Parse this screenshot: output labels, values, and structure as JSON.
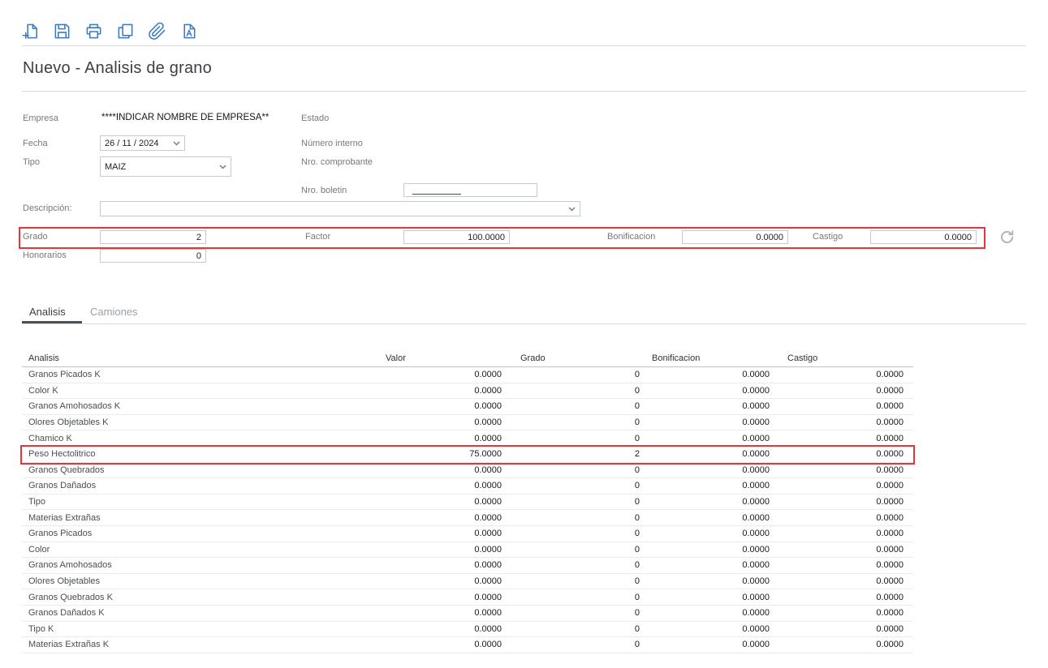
{
  "title": "Nuevo - Analisis de grano",
  "toolbar": {
    "icons": [
      "new-document-icon",
      "save-icon",
      "print-icon",
      "copy-icon",
      "paperclip-icon",
      "text-a-icon"
    ]
  },
  "form": {
    "empresa": {
      "label": "Empresa",
      "value": "****INDICAR NOMBRE DE EMPRESA**"
    },
    "estado": {
      "label": "Estado"
    },
    "fecha": {
      "label": "Fecha",
      "value": "26 / 11 /  2024"
    },
    "numero_interno": {
      "label": "Número interno"
    },
    "tipo": {
      "label": "Tipo",
      "value": "MAIZ"
    },
    "nro_comprobante": {
      "label": "Nro. comprobante"
    },
    "nro_boletin": {
      "label": "Nro. boletin",
      "value": ""
    },
    "descripcion": {
      "label": "Descripción:",
      "value": ""
    },
    "grado": {
      "label": "Grado",
      "value": "2"
    },
    "factor": {
      "label": "Factor",
      "value": "100.0000"
    },
    "bonificacion": {
      "label": "Bonificacion",
      "value": "0.0000"
    },
    "castigo": {
      "label": "Castigo",
      "value": "0.0000"
    },
    "honorarios": {
      "label": "Honorarios",
      "value": "0"
    }
  },
  "tabs": [
    {
      "label": "Analisis",
      "active": true
    },
    {
      "label": "Camiones",
      "active": false
    }
  ],
  "table": {
    "headers": [
      "Analisis",
      "Valor",
      "Grado",
      "Bonificacion",
      "Castigo"
    ],
    "rows": [
      {
        "analisis": "Granos Picados K",
        "valor": "0.0000",
        "grado": "0",
        "bonificacion": "0.0000",
        "castigo": "0.0000"
      },
      {
        "analisis": "Color K",
        "valor": "0.0000",
        "grado": "0",
        "bonificacion": "0.0000",
        "castigo": "0.0000"
      },
      {
        "analisis": "Granos Amohosados K",
        "valor": "0.0000",
        "grado": "0",
        "bonificacion": "0.0000",
        "castigo": "0.0000"
      },
      {
        "analisis": "Olores Objetables K",
        "valor": "0.0000",
        "grado": "0",
        "bonificacion": "0.0000",
        "castigo": "0.0000"
      },
      {
        "analisis": "Chamico K",
        "valor": "0.0000",
        "grado": "0",
        "bonificacion": "0.0000",
        "castigo": "0.0000"
      },
      {
        "analisis": "Peso Hectolitrico",
        "valor": "75.0000",
        "grado": "2",
        "bonificacion": "0.0000",
        "castigo": "0.0000",
        "highlight": true
      },
      {
        "analisis": "Granos Quebrados",
        "valor": "0.0000",
        "grado": "0",
        "bonificacion": "0.0000",
        "castigo": "0.0000"
      },
      {
        "analisis": "Granos Dañados",
        "valor": "0.0000",
        "grado": "0",
        "bonificacion": "0.0000",
        "castigo": "0.0000"
      },
      {
        "analisis": "Tipo",
        "valor": "0.0000",
        "grado": "0",
        "bonificacion": "0.0000",
        "castigo": "0.0000"
      },
      {
        "analisis": "Materias Extrañas",
        "valor": "0.0000",
        "grado": "0",
        "bonificacion": "0.0000",
        "castigo": "0.0000"
      },
      {
        "analisis": "Granos Picados",
        "valor": "0.0000",
        "grado": "0",
        "bonificacion": "0.0000",
        "castigo": "0.0000"
      },
      {
        "analisis": "Color",
        "valor": "0.0000",
        "grado": "0",
        "bonificacion": "0.0000",
        "castigo": "0.0000"
      },
      {
        "analisis": "Granos Amohosados",
        "valor": "0.0000",
        "grado": "0",
        "bonificacion": "0.0000",
        "castigo": "0.0000"
      },
      {
        "analisis": "Olores Objetables",
        "valor": "0.0000",
        "grado": "0",
        "bonificacion": "0.0000",
        "castigo": "0.0000"
      },
      {
        "analisis": "Granos Quebrados K",
        "valor": "0.0000",
        "grado": "0",
        "bonificacion": "0.0000",
        "castigo": "0.0000"
      },
      {
        "analisis": "Granos Dañados K",
        "valor": "0.0000",
        "grado": "0",
        "bonificacion": "0.0000",
        "castigo": "0.0000"
      },
      {
        "analisis": "Tipo K",
        "valor": "0.0000",
        "grado": "0",
        "bonificacion": "0.0000",
        "castigo": "0.0000"
      },
      {
        "analisis": "Materias Extrañas K",
        "valor": "0.0000",
        "grado": "0",
        "bonificacion": "0.0000",
        "castigo": "0.0000"
      }
    ]
  },
  "colors": {
    "accent_blue": "#3a79bd",
    "highlight_red": "#e8353a",
    "divider_gray": "#dadada",
    "label_gray": "#75797d"
  }
}
